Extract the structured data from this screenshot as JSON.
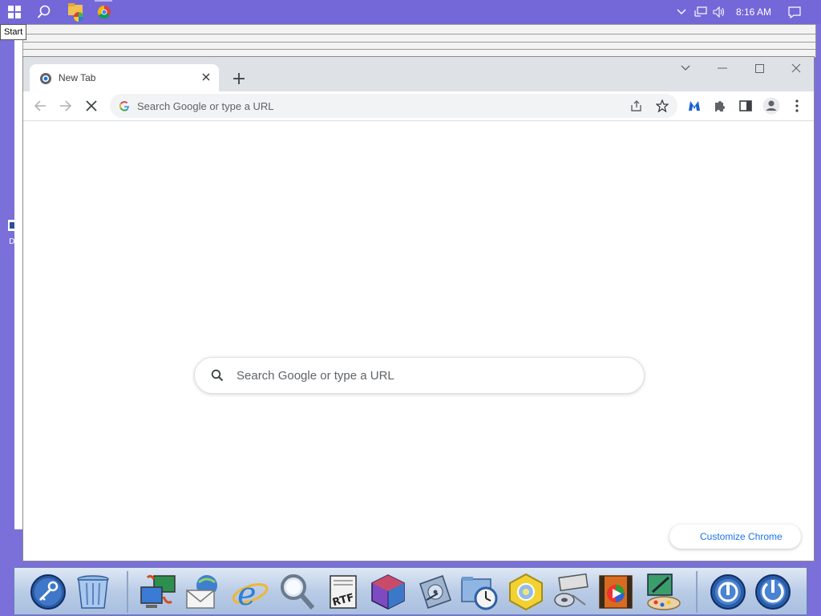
{
  "taskbar": {
    "start_tooltip": "Start",
    "clock": "8:16 AM",
    "icons": [
      "windows-start-icon",
      "search-icon",
      "file-explorer-icon",
      "chrome-icon"
    ]
  },
  "browser": {
    "tab": {
      "title": "New Tab"
    },
    "omnibox": {
      "placeholder": "Search Google or type a URL"
    },
    "ntp_search": {
      "placeholder": "Search Google or type a URL"
    },
    "customize_label": "Customize Chrome"
  },
  "dock": {
    "items": [
      "keychain-icon",
      "trash-icon",
      "network-computer-icon",
      "mail-icon",
      "internet-explorer-icon",
      "search-magnifier-icon",
      "rtf-document-icon",
      "cube-app-icon",
      "disk-utility-icon",
      "clock-folder-icon",
      "hex-settings-icon",
      "media-player-icon",
      "video-film-icon",
      "paint-art-icon",
      "logoff-power-icon",
      "shutdown-power-icon"
    ]
  },
  "colors": {
    "desktop": "#7b6fd9",
    "taskbar": "#7467d8",
    "tabstrip": "#dee1e6",
    "link_blue": "#1a73e8"
  }
}
